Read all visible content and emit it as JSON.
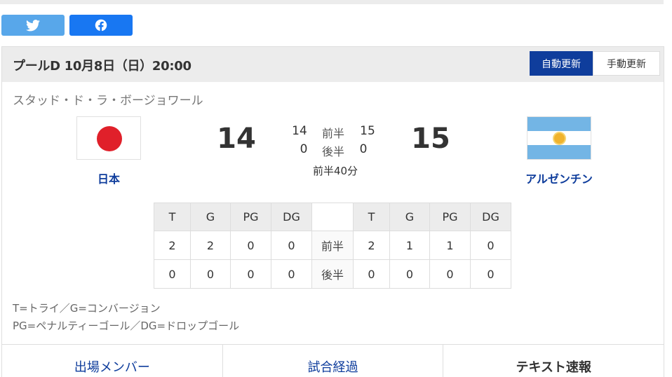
{
  "share": {
    "twitter_icon": "twitter-bird-icon",
    "facebook_icon": "facebook-f-icon"
  },
  "header": {
    "title": "プールD  10月8日（日）20:00",
    "auto_update": "自動更新",
    "manual_update": "手動更新"
  },
  "venue": "スタッド・ド・ラ・ボージョワール",
  "home": {
    "name": "日本",
    "score": "14",
    "first_half": "14",
    "second_half": "0",
    "flag": "japan-flag"
  },
  "away": {
    "name": "アルゼンチン",
    "score": "15",
    "first_half": "15",
    "second_half": "0",
    "flag": "argentina-flag"
  },
  "halves": {
    "first": "前半",
    "second": "後半"
  },
  "match_time": "前半40分",
  "stats": {
    "headers": [
      "T",
      "G",
      "PG",
      "DG"
    ],
    "rows": [
      {
        "label": "前半",
        "home": [
          "2",
          "2",
          "0",
          "0"
        ],
        "away": [
          "2",
          "1",
          "1",
          "0"
        ]
      },
      {
        "label": "後半",
        "home": [
          "0",
          "0",
          "0",
          "0"
        ],
        "away": [
          "0",
          "0",
          "0",
          "0"
        ]
      }
    ]
  },
  "legend": {
    "line1": "T=トライ／G=コンバージョン",
    "line2": "PG=ペナルティーゴール／DG=ドロップゴール"
  },
  "tabs": [
    {
      "label": "出場メンバー"
    },
    {
      "label": "試合経過"
    },
    {
      "label": "テキスト速報"
    }
  ],
  "colors": {
    "accent": "#0f3d9c",
    "twitter": "#58a7ea",
    "facebook": "#1877f2",
    "japan_red": "#e0202a",
    "argentina_blue": "#73b5e5"
  }
}
